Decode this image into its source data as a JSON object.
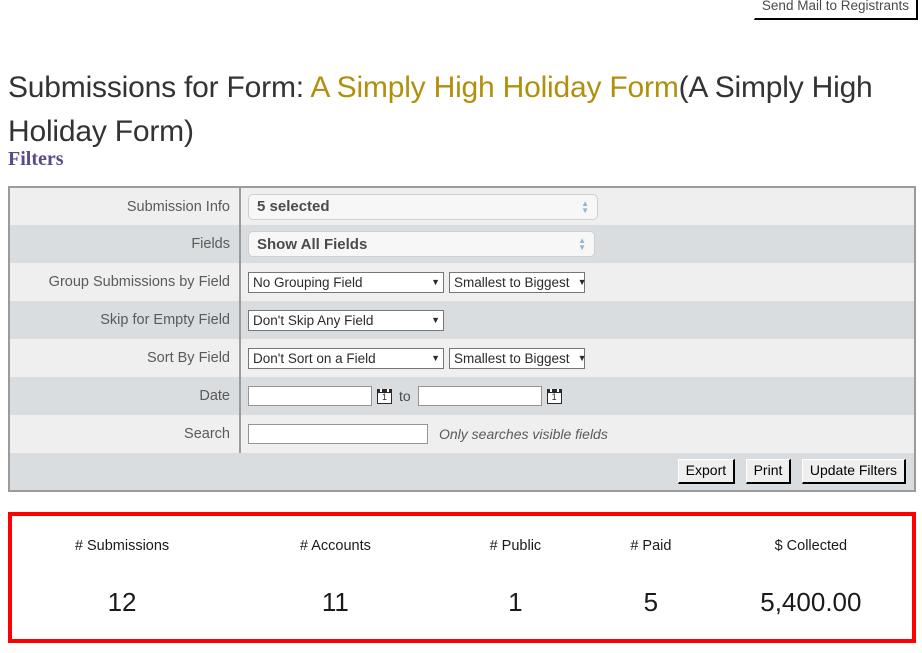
{
  "topbar": {
    "send_mail_label": "Send Mail to Registrants"
  },
  "title": {
    "prefix": "Submissions for Form: ",
    "form_name": "A Simply High Holiday Form",
    "suffix": "(A Simply High Holiday Form)"
  },
  "filters_heading": "Filters",
  "filters": {
    "rows": [
      {
        "label": "Submission Info",
        "value": "5 selected"
      },
      {
        "label": "Fields",
        "value": "Show All Fields"
      },
      {
        "label": "Group Submissions by Field",
        "value": "No Grouping Field",
        "order": "Smallest to Biggest"
      },
      {
        "label": "Skip for Empty Field",
        "value": "Don't Skip Any Field"
      },
      {
        "label": "Sort By Field",
        "value": "Don't Sort on a Field",
        "order": "Smallest to Biggest"
      },
      {
        "label": "Date",
        "from_value": "",
        "to_word": "to",
        "to_value": "",
        "calendar_glyph": "1"
      },
      {
        "label": "Search",
        "value": "",
        "hint": "Only searches visible fields"
      }
    ]
  },
  "actions": {
    "export_label": "Export",
    "print_label": "Print",
    "update_label": "Update Filters"
  },
  "stats": {
    "border_color": "#ff0000",
    "headers": [
      "# Submissions",
      "# Accounts",
      "# Public",
      "# Paid",
      "$ Collected"
    ],
    "values": [
      "12",
      "11",
      "1",
      "5",
      "5,400.00"
    ]
  },
  "colors": {
    "form_name": "#b0900c",
    "filters_heading": "#5b4a8a",
    "row_odd": "#efefef",
    "row_even": "#d9dde0",
    "table_border": "#9b9b9b"
  }
}
